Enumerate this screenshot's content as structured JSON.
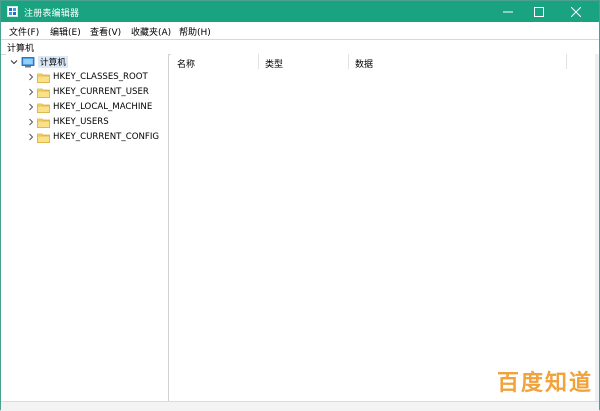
{
  "window": {
    "title": "注册表编辑器",
    "colors": {
      "titlebar": "#1aa380",
      "selection": "#dbe8f6"
    }
  },
  "menu": {
    "items": [
      "文件(F)",
      "编辑(E)",
      "查看(V)",
      "收藏夹(A)",
      "帮助(H)"
    ]
  },
  "address": {
    "path": "计算机"
  },
  "tree": {
    "root": {
      "label": "计算机",
      "icon": "computer-icon",
      "expanded": true
    },
    "children": [
      {
        "label": "HKEY_CLASSES_ROOT",
        "icon": "folder-icon"
      },
      {
        "label": "HKEY_CURRENT_USER",
        "icon": "folder-icon"
      },
      {
        "label": "HKEY_LOCAL_MACHINE",
        "icon": "folder-icon"
      },
      {
        "label": "HKEY_USERS",
        "icon": "folder-icon"
      },
      {
        "label": "HKEY_CURRENT_CONFIG",
        "icon": "folder-icon"
      }
    ]
  },
  "list": {
    "columns": [
      "名称",
      "类型",
      "数据"
    ]
  },
  "watermark": {
    "text": "百度知道"
  }
}
